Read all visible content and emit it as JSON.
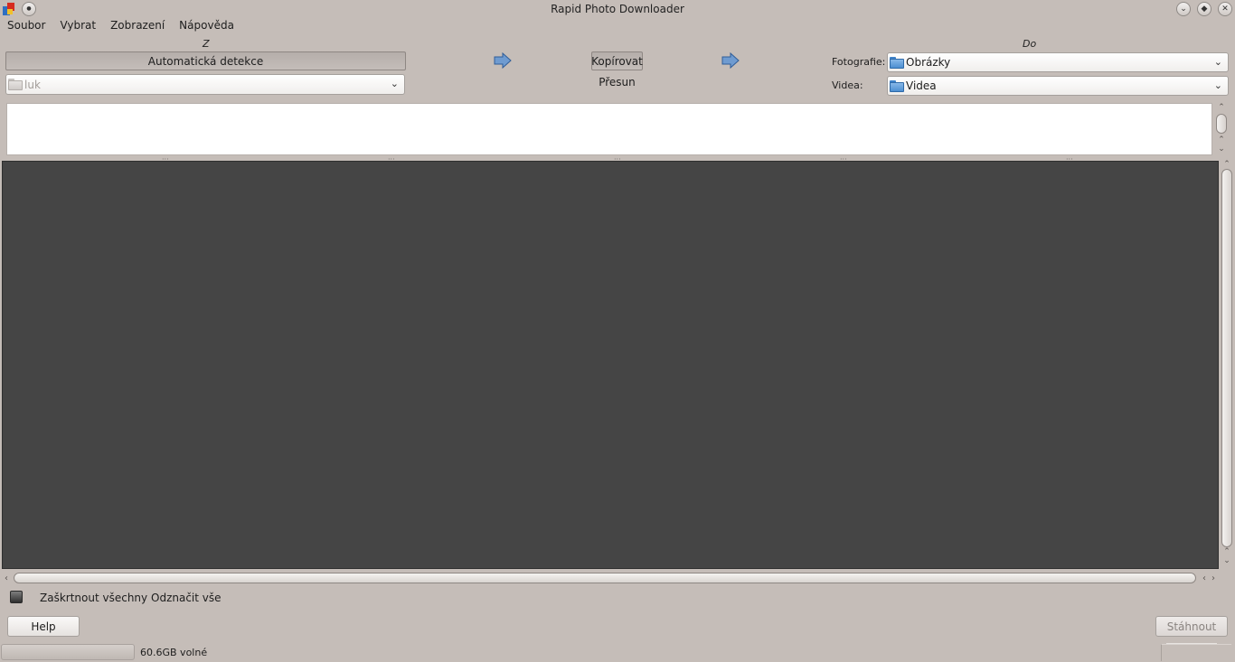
{
  "window": {
    "title": "Rapid Photo Downloader",
    "icons": {
      "app": "app-icon",
      "minimize": "chevron-down-icon",
      "maximize": "maximize-icon",
      "close": "close-icon",
      "menu": "window-menu-icon"
    }
  },
  "menu": [
    "Soubor",
    "Vybrat",
    "Zobrazení",
    "Nápověda"
  ],
  "source": {
    "label": "Z",
    "autodetect_button": "Automatická detekce",
    "location": {
      "value": "luk",
      "icon": "folder-icon"
    }
  },
  "mode": {
    "copy_button": "Kopírovat",
    "move_label": "Přesun",
    "arrow_icon": "arrow-right-icon"
  },
  "destination": {
    "label": "Do",
    "photos": {
      "label": "Fotografie:",
      "value": "Obrázky",
      "icon": "folder-icon"
    },
    "videos": {
      "label": "Videa:",
      "value": "Videa",
      "icon": "folder-icon"
    }
  },
  "selection": {
    "check_all": "Zaškrtnout všechny",
    "uncheck_all": "Odznačit vše"
  },
  "footer": {
    "help_button": "Help",
    "download_button": "Stáhnout",
    "free_space": "60.6GB volné"
  },
  "colors": {
    "background": "#c5bdb8",
    "thumbnail_area": "#454545",
    "folder_blue": "#4d8fd1"
  }
}
